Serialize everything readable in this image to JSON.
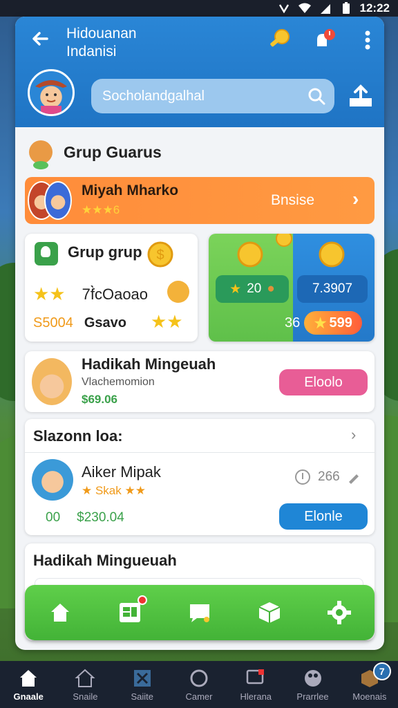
{
  "status_bar": {
    "time": "12:22"
  },
  "header": {
    "title_line1": "Hidouanan",
    "title_line2": "Indanisi"
  },
  "search": {
    "value": "Socholandgalhal"
  },
  "group": {
    "title": "Grup Guarus"
  },
  "featured_row": {
    "name": "Miyah Mharko",
    "rating": "★★★6",
    "right_label": "Bnsise"
  },
  "left_card": {
    "title": "Grup grup",
    "row2_value": "7f̀cOaoao",
    "row3_left": "S5004",
    "row3_right": "Gsavo"
  },
  "right_card": {
    "pill_left": "20",
    "pill_right": "7.3907",
    "bottom_number": "36",
    "badge_value": "599"
  },
  "hadikah": {
    "title": "Hadikah Mingeuah",
    "subtitle": "Vlachemomion",
    "price": "$69.06",
    "button": "Eloolo"
  },
  "season": {
    "title": "Slazonn loa:",
    "name": "Aiker Mipak",
    "rating": "★ Skak ★★",
    "info_count": "266",
    "row3_a": "00",
    "row3_b": "$230.04",
    "button": "Elonle"
  },
  "last_card": {
    "title": "Hadikah Mingueuah"
  },
  "bottom_nav": {
    "items": [
      "home-icon",
      "board-icon",
      "chat-icon",
      "box-icon",
      "settings-icon"
    ]
  },
  "sys_nav": {
    "items": [
      {
        "label": "Gnaale",
        "icon": "home-icon"
      },
      {
        "label": "Snaile",
        "icon": "house-outline-icon"
      },
      {
        "label": "Saiite",
        "icon": "x-icon"
      },
      {
        "label": "Camer",
        "icon": "circle-icon"
      },
      {
        "label": "Hlerana",
        "icon": "chat-icon"
      },
      {
        "label": "Prarrlee",
        "icon": "palette-icon"
      },
      {
        "label": "Moenais",
        "icon": "box-icon"
      }
    ],
    "badge": "7"
  },
  "colors": {
    "header_blue": "#2a86d6",
    "orange": "#ff8c3a",
    "green": "#5fcf4a",
    "pink": "#e85d96",
    "blue_button": "#1f86d6"
  }
}
